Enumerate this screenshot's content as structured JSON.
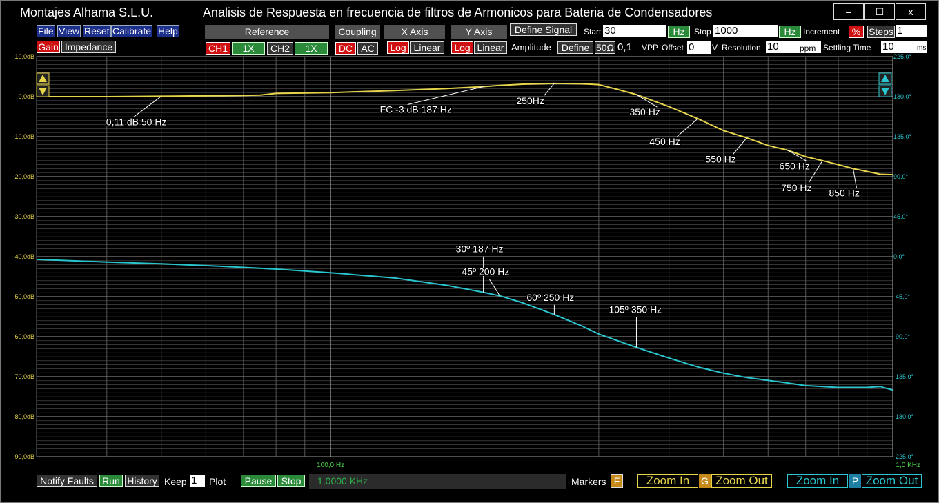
{
  "window": {
    "app_name": "Montajes Alhama S.L.U.",
    "title": "Analisis de Respuesta en frecuencia de filtros de Armonicos para Bateria de Condensadores",
    "minimize": "–",
    "maximize": "☐",
    "close": "x"
  },
  "menu": {
    "file": "File",
    "view": "View",
    "reset": "Reset",
    "calibrate": "Calibrate",
    "help": "Help",
    "gain": "Gain",
    "impedance": "Impedance"
  },
  "headers": {
    "reference": "Reference",
    "coupling": "Coupling",
    "x_axis": "X Axis",
    "y_axis": "Y Axis"
  },
  "controls": {
    "ch1": "CH1",
    "ch1_scale": "1X",
    "ch2": "CH2",
    "ch2_scale": "1X",
    "dc": "DC",
    "ac": "AC",
    "x_log": "Log",
    "x_linear": "Linear",
    "y_log": "Log",
    "y_linear": "Linear",
    "define_signal": "Define Signal",
    "amplitude_label": "Amplitude",
    "define": "Define",
    "ohm": "50Ω",
    "amplitude_value": "0,1",
    "amplitude_unit": "VPP",
    "offset_label": "Offset",
    "offset_value": "0",
    "offset_unit": "V",
    "resolution_label": "Resolution",
    "resolution_value": "10",
    "resolution_unit": "ppm",
    "settling_label": "Settling Time",
    "settling_value": "10",
    "settling_unit": "ms",
    "start_label": "Start",
    "start_value": "30",
    "start_unit": "Hz",
    "stop_label": "Stop",
    "stop_value": "1000",
    "stop_unit": "Hz",
    "increment_label": "Increment",
    "increment_unit": "%",
    "steps_label": "Steps",
    "steps_value": "1"
  },
  "bottom": {
    "notify_faults": "Notify Faults",
    "run": "Run",
    "history": "History",
    "keep_label": "Keep",
    "keep_value": "1",
    "plot_label": "Plot",
    "pause": "Pause",
    "stop": "Stop",
    "status_frequency": "1,0000 KHz",
    "markers_label": "Markers",
    "markers_key": "F",
    "gain_zoom_in": "Zoom In",
    "gain_zoom_key": "G",
    "gain_zoom_out": "Zoom Out",
    "phase_zoom_in": "Zoom In",
    "phase_zoom_key": "P",
    "phase_zoom_out": "Zoom Out"
  },
  "colors": {
    "gain": "#e6d44a",
    "phase": "#29c6cf",
    "grid": "#555555",
    "background": "#000000"
  },
  "chart_data": {
    "type": "line",
    "x_scale": "log",
    "xlim": [
      30,
      1000
    ],
    "x_tick_labels": [
      "100,0 Hz",
      "1,0 KHz"
    ],
    "y_left": {
      "label_unit": "dB",
      "ylim": [
        -90,
        10
      ],
      "ticks": [
        "10,0dB",
        "0,0dB",
        "-10,0dB",
        "-20,0dB",
        "-30,0dB",
        "-40,0dB",
        "-50,0dB",
        "-60,0dB",
        "-70,0dB",
        "-80,0dB",
        "-90,0dB"
      ]
    },
    "y_right": {
      "label_unit": "degrees",
      "ylim": [
        -225,
        225
      ],
      "ticks": [
        "225,0°",
        "180,0°",
        "135,0°",
        "90,0°",
        "45,0°",
        "0,0°",
        "-45,0°",
        "-90,0°",
        "-135,0°",
        "-180,0°",
        "-225,0°"
      ]
    },
    "series": [
      {
        "axis": "left",
        "color": "#e6d44a",
        "x": [
          30,
          40,
          50,
          60,
          70,
          75,
          80,
          100,
          130,
          160,
          187,
          200,
          220,
          250,
          280,
          300,
          320,
          350,
          400,
          450,
          500,
          550,
          600,
          650,
          700,
          750,
          800,
          850,
          900,
          950,
          1000
        ],
        "y": [
          0.0,
          0.0,
          0.1,
          0.2,
          0.3,
          0.4,
          0.8,
          1.0,
          1.5,
          2.0,
          2.5,
          2.8,
          3.1,
          3.3,
          3.2,
          3.0,
          2.0,
          0.5,
          -2.5,
          -5.5,
          -8.5,
          -10.3,
          -12.2,
          -13.4,
          -15.0,
          -16.0,
          -17.0,
          -18.0,
          -18.7,
          -19.4,
          -19.5
        ]
      },
      {
        "axis": "right",
        "color": "#29c6cf",
        "x": [
          30,
          40,
          50,
          60,
          70,
          80,
          100,
          130,
          160,
          187,
          200,
          220,
          250,
          280,
          300,
          350,
          400,
          450,
          500,
          550,
          600,
          650,
          700,
          750,
          800,
          850,
          900,
          950,
          1000
        ],
        "y": [
          -3,
          -6,
          -8,
          -10,
          -12,
          -14,
          -18,
          -24,
          -32,
          -40,
          -44,
          -52,
          -65,
          -78,
          -87,
          -102,
          -114,
          -124,
          -131,
          -136,
          -139,
          -142,
          -145,
          -146,
          -147,
          -147,
          -147,
          -146,
          -150
        ]
      }
    ],
    "annotations": [
      {
        "text": "0,11 dB 50 Hz",
        "x": 50,
        "y": 0.1,
        "axis": "left"
      },
      {
        "text": "FC -3 dB 187 Hz",
        "x": 187,
        "y": 2.5,
        "axis": "left"
      },
      {
        "text": "250Hz",
        "x": 250,
        "y": 3.3,
        "axis": "left"
      },
      {
        "text": "350 Hz",
        "x": 350,
        "y": 0.5,
        "axis": "left"
      },
      {
        "text": "450 Hz",
        "x": 450,
        "y": -5.5,
        "axis": "left"
      },
      {
        "text": "550 Hz",
        "x": 550,
        "y": -10.3,
        "axis": "left"
      },
      {
        "text": "650 Hz",
        "x": 650,
        "y": -13.4,
        "axis": "left"
      },
      {
        "text": "750 Hz",
        "x": 750,
        "y": -16.0,
        "axis": "left"
      },
      {
        "text": "850 Hz",
        "x": 850,
        "y": -18.0,
        "axis": "left"
      },
      {
        "text": "30º 187 Hz",
        "x": 187,
        "y": -40,
        "axis": "right"
      },
      {
        "text": "45º 200 Hz",
        "x": 200,
        "y": -44,
        "axis": "right"
      },
      {
        "text": "60º 250 Hz",
        "x": 250,
        "y": -65,
        "axis": "right"
      },
      {
        "text": "105º 350 Hz",
        "x": 350,
        "y": -102,
        "axis": "right"
      }
    ]
  }
}
